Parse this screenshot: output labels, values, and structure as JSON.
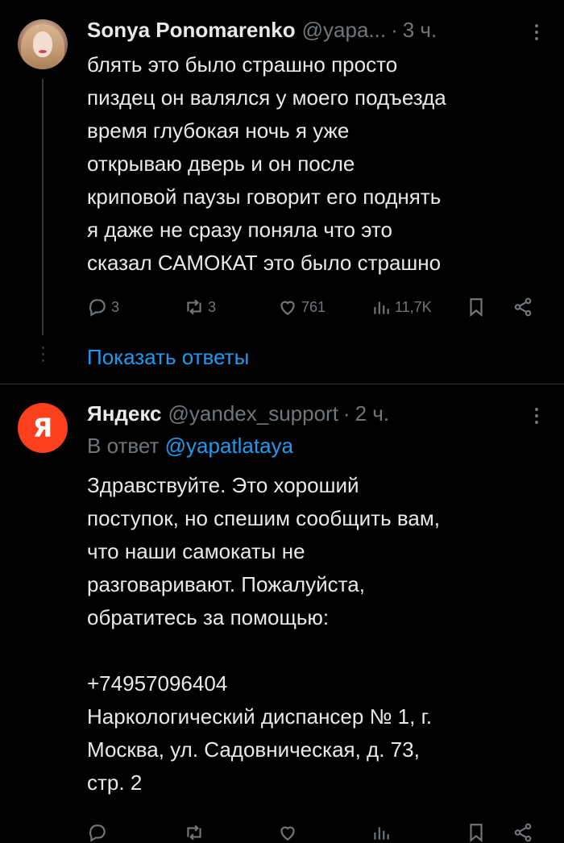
{
  "tweet1": {
    "author_name": "Sonya Ponomarenko",
    "handle": "@yapa...",
    "separator": "·",
    "time": "3 ч.",
    "text": "блять это было страшно просто\nпиздец он валялся у моего подъезда\nвремя глубокая ночь я уже\nоткрываю дверь и он после\nкриповой паузы говорит его поднять\nя даже не сразу поняла что это\nсказал САМОКАТ это было страшно",
    "stats": {
      "replies": "3",
      "retweets": "3",
      "likes": "761",
      "views": "11,7K"
    },
    "show_replies": "Показать ответы"
  },
  "tweet2": {
    "author_name": "Яндекс",
    "avatar_letter": "Я",
    "handle": "@yandex_support",
    "separator": "·",
    "time": "2 ч.",
    "reply_prefix": "В ответ",
    "reply_handle": "@yapatlataya",
    "text": "Здравствуйте. Это хороший\nпоступок, но спешим сообщить вам,\nчто наши самокаты не\nразговаривают. Пожалуйста,\nобратитесь за помощью:\n\n+74957096404\nНаркологический диспансер № 1, г.\nМосква, ул. Садовническая, д. 73,\nстр. 2"
  },
  "colors": {
    "background": "#000000",
    "text_primary": "#e7e9ea",
    "text_secondary": "#71767b",
    "link": "#1d9bf0",
    "divider": "#2f3336",
    "yandex_brand": "#fc3f1d"
  },
  "icons": {
    "reply": "reply-icon",
    "retweet": "retweet-icon",
    "like": "heart-icon",
    "views": "views-icon",
    "bookmark": "bookmark-icon",
    "share": "share-icon",
    "more": "more-icon"
  }
}
